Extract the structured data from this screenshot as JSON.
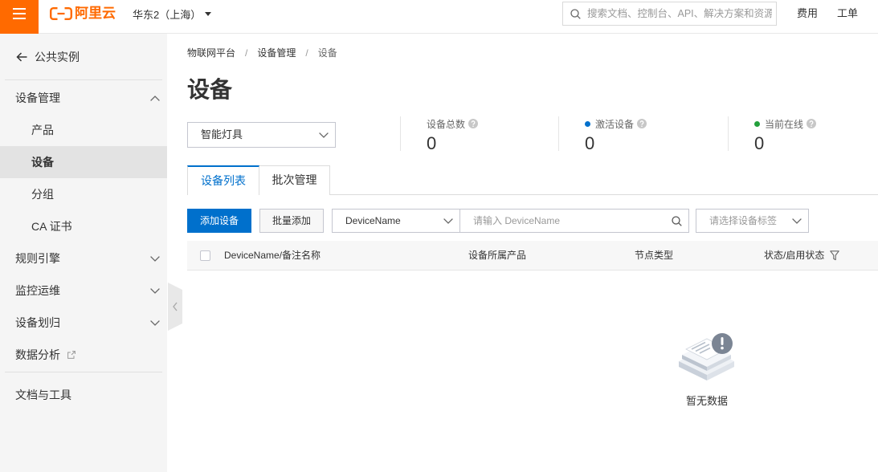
{
  "topbar": {
    "menu_icon": "menu-icon",
    "logo_text": "阿里云",
    "region": "华东2（上海）",
    "search_placeholder": "搜索文档、控制台、API、解决方案和资源",
    "links": [
      {
        "label": "费用"
      },
      {
        "label": "工单"
      }
    ]
  },
  "sidebar": {
    "back": {
      "label": "公共实例",
      "icon": "arrow-left-icon"
    },
    "items": [
      {
        "label": "设备管理",
        "expanded": true,
        "icon": "chevron-up-icon"
      },
      {
        "label": "产品",
        "child": true
      },
      {
        "label": "设备",
        "child": true,
        "active": true
      },
      {
        "label": "分组",
        "child": true
      },
      {
        "label": "CA 证书",
        "child": true
      },
      {
        "label": "规则引擎",
        "expanded": false,
        "icon": "chevron-down-icon"
      },
      {
        "label": "监控运维",
        "expanded": false,
        "icon": "chevron-down-icon"
      },
      {
        "label": "设备划归",
        "expanded": false,
        "icon": "chevron-down-icon"
      },
      {
        "label": "数据分析",
        "icon": "external-link-icon"
      }
    ],
    "footer": {
      "label": "文档与工具"
    }
  },
  "breadcrumb": {
    "separator": "/",
    "items": [
      "物联网平台",
      "设备管理",
      "设备"
    ]
  },
  "page": {
    "title": "设备",
    "product_select": {
      "value": "智能灯具"
    },
    "stats": [
      {
        "label": "设备总数",
        "value": 0
      },
      {
        "label": "激活设备",
        "value": 0
      },
      {
        "label": "当前在线",
        "value": 0
      }
    ],
    "tabs": [
      {
        "label": "设备列表",
        "active": true
      },
      {
        "label": "批次管理",
        "active": false
      }
    ],
    "toolbar": {
      "add_button": "添加设备",
      "batch_add_button": "批量添加",
      "search_field": "DeviceName",
      "search_placeholder": "请输入 DeviceName",
      "tag_placeholder": "请选择设备标签"
    },
    "table": {
      "columns": [
        "DeviceName/备注名称",
        "设备所属产品",
        "节点类型",
        "状态/启用状态"
      ],
      "rows": [],
      "empty_text": "暂无数据"
    }
  },
  "colors": {
    "brand": "#ff6a00",
    "primary": "#0070cc",
    "active_dot": "#0070cc",
    "online_dot": "#23a03c"
  }
}
